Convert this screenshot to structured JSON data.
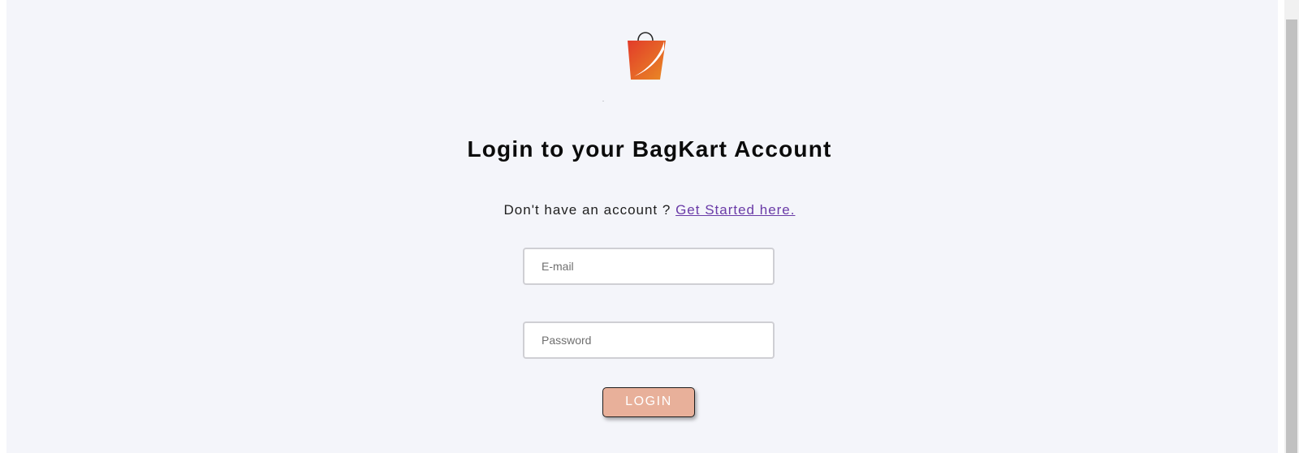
{
  "brand": {
    "logo_icon": "shopping-bag-icon",
    "colors": {
      "logo_red": "#e23b2a",
      "logo_orange": "#e98a25",
      "background": "#f4f5fa",
      "link": "#6a3ba7",
      "button": "#e8b09a"
    }
  },
  "login": {
    "title": "Login to your BagKart Account",
    "signup_prompt": "Don't have an account ?",
    "signup_link": "Get Started here.",
    "email_placeholder": "E-mail",
    "email_value": "",
    "password_placeholder": "Password",
    "password_value": "",
    "login_button": "LOGIN"
  }
}
